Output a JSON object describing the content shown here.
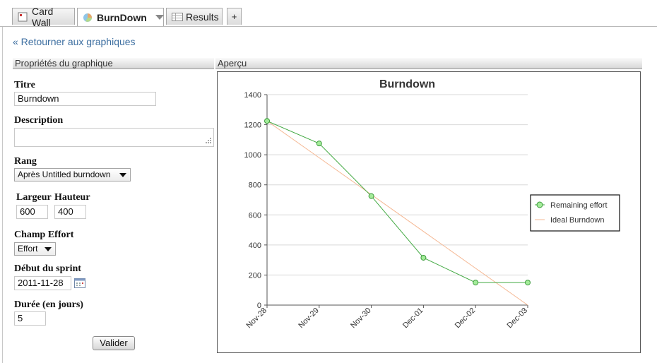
{
  "tabs": [
    {
      "label": "Card Wall",
      "icon": "card-wall-icon"
    },
    {
      "label": "BurnDown",
      "icon": "pie-chart-icon",
      "active": true
    },
    {
      "label": "Results",
      "icon": "table-icon"
    },
    {
      "label": "+"
    }
  ],
  "back_link": "« Retourner aux graphiques",
  "sections": {
    "properties": "Propriétés du graphique",
    "preview": "Aperçu"
  },
  "form": {
    "title_label": "Titre",
    "title_value": "Burndown",
    "description_label": "Description",
    "description_value": "",
    "rank_label": "Rang",
    "rank_value": "Après Untitled burndown",
    "width_label": "Largeur",
    "width_value": "600",
    "height_label": "Hauteur",
    "height_value": "400",
    "effort_label": "Champ Effort",
    "effort_value": "Effort",
    "start_label": "Début du sprint",
    "start_value": "2011-11-28",
    "duration_label": "Durée (en jours)",
    "duration_value": "5",
    "submit_label": "Valider"
  },
  "chart_data": {
    "type": "line",
    "title": "Burndown",
    "categories": [
      "Nov-28",
      "Nov-29",
      "Nov-30",
      "Dec-01",
      "Dec-02",
      "Dec-03"
    ],
    "series": [
      {
        "name": "Remaining effort",
        "values": [
          1225,
          1075,
          725,
          315,
          150,
          150
        ],
        "color": "#44aa44",
        "markers": true
      },
      {
        "name": "Ideal Burndown",
        "values": [
          1225,
          980,
          735,
          490,
          245,
          0
        ],
        "color": "#f5b894",
        "markers": false
      }
    ],
    "ylim": [
      0,
      1400
    ],
    "yticks": [
      0,
      200,
      400,
      600,
      800,
      1000,
      1200,
      1400
    ],
    "grid": true,
    "legend": "right"
  }
}
